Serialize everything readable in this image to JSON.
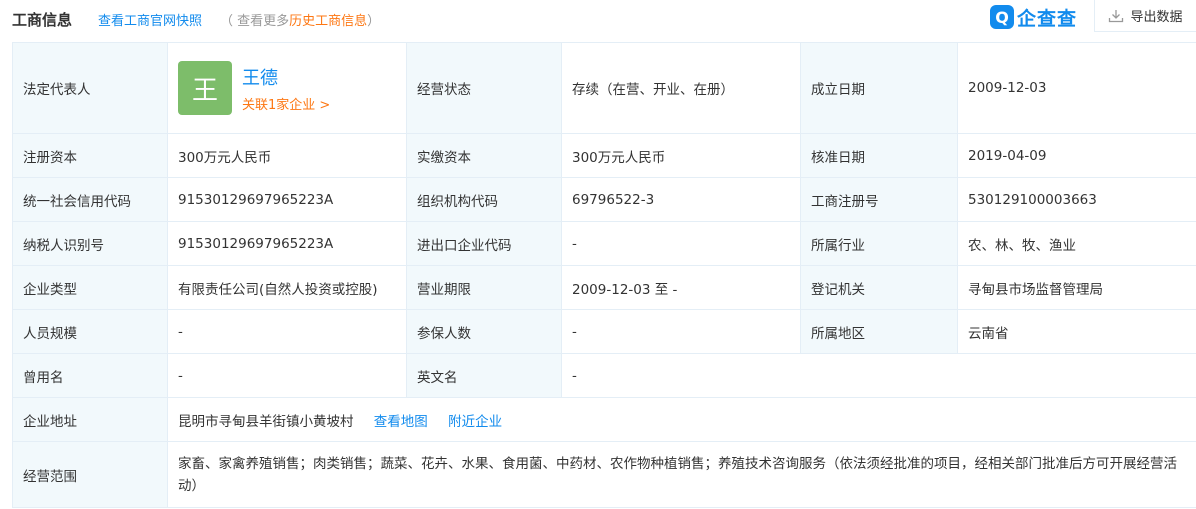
{
  "header": {
    "title": "工商信息",
    "snapshot_link": "查看工商官网快照",
    "history_prefix": "（ 查看更多",
    "history_link": "历史工商信息",
    "history_suffix": "）",
    "brand_icon_char": "Q",
    "brand_text": "企查查",
    "export_label": "导出数据"
  },
  "legal_rep": {
    "label": "法定代表人",
    "avatar_char": "王",
    "name": "王德",
    "related": "关联1家企业 >"
  },
  "rows": {
    "status": {
      "label": "经营状态",
      "value": "存续（在营、开业、在册）"
    },
    "founded": {
      "label": "成立日期",
      "value": "2009-12-03"
    },
    "reg_capital": {
      "label": "注册资本",
      "value": "300万元人民币"
    },
    "paid_capital": {
      "label": "实缴资本",
      "value": "300万元人民币"
    },
    "approval_date": {
      "label": "核准日期",
      "value": "2019-04-09"
    },
    "credit_code": {
      "label": "统一社会信用代码",
      "value": "91530129697965223A"
    },
    "org_code": {
      "label": "组织机构代码",
      "value": "69796522-3"
    },
    "reg_no": {
      "label": "工商注册号",
      "value": "530129100003663"
    },
    "taxpayer_id": {
      "label": "纳税人识别号",
      "value": "91530129697965223A"
    },
    "import_export": {
      "label": "进出口企业代码",
      "value": "-"
    },
    "industry": {
      "label": "所属行业",
      "value": "农、林、牧、渔业"
    },
    "company_type": {
      "label": "企业类型",
      "value": "有限责任公司(自然人投资或控股)"
    },
    "business_term": {
      "label": "营业期限",
      "value": "2009-12-03 至 -"
    },
    "registrar": {
      "label": "登记机关",
      "value": "寻甸县市场监督管理局"
    },
    "staff_size": {
      "label": "人员规模",
      "value": "-"
    },
    "insured": {
      "label": "参保人数",
      "value": "-"
    },
    "region": {
      "label": "所属地区",
      "value": "云南省"
    },
    "former_name": {
      "label": "曾用名",
      "value": "-"
    },
    "english_name": {
      "label": "英文名",
      "value": "-"
    },
    "address": {
      "label": "企业地址",
      "value": "昆明市寻甸县羊街镇小黄坡村",
      "map_link": "查看地图",
      "nearby_link": "附近企业"
    },
    "scope": {
      "label": "经营范围",
      "value": "家畜、家禽养殖销售；肉类销售；蔬菜、花卉、水果、食用菌、中药材、农作物种植销售；养殖技术咨询服务（依法须经批准的项目，经相关部门批准后方可开展经营活动）"
    }
  }
}
